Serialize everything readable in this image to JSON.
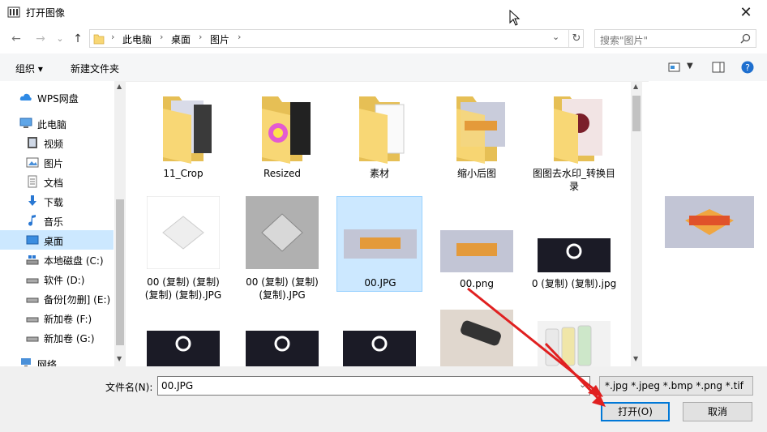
{
  "window": {
    "title": "打开图像",
    "close_glyph": "✕"
  },
  "nav": {
    "back_glyph": "←",
    "forward_glyph": "→",
    "recent_glyph": "⌄",
    "up_glyph": "↑",
    "breadcrumbs": [
      "此电脑",
      "桌面",
      "图片"
    ],
    "refresh_glyph": "↻",
    "search_placeholder": "搜索\"图片\""
  },
  "toolbar": {
    "organize_label": "组织 ▾",
    "new_folder_label": "新建文件夹"
  },
  "sidebar": {
    "items": [
      {
        "label": "WPS网盘",
        "icon": "cloud-icon"
      },
      {
        "label": "此电脑",
        "icon": "computer-icon"
      },
      {
        "label": "视频",
        "icon": "video-icon"
      },
      {
        "label": "图片",
        "icon": "pictures-icon"
      },
      {
        "label": "文档",
        "icon": "document-icon"
      },
      {
        "label": "下载",
        "icon": "download-icon"
      },
      {
        "label": "音乐",
        "icon": "music-icon"
      },
      {
        "label": "桌面",
        "icon": "desktop-icon",
        "selected": true
      },
      {
        "label": "本地磁盘 (C:)",
        "icon": "drive-icon"
      },
      {
        "label": "软件 (D:)",
        "icon": "drive-icon"
      },
      {
        "label": "备份[勿删] (E:)",
        "icon": "drive-icon"
      },
      {
        "label": "新加卷 (F:)",
        "icon": "drive-icon"
      },
      {
        "label": "新加卷 (G:)",
        "icon": "drive-icon"
      },
      {
        "label": "网络",
        "icon": "network-icon"
      }
    ]
  },
  "files": [
    {
      "name": "11_Crop",
      "kind": "folder"
    },
    {
      "name": "Resized",
      "kind": "folder"
    },
    {
      "name": "素材",
      "kind": "folder"
    },
    {
      "name": "缩小后图",
      "kind": "folder"
    },
    {
      "name": "图图去水印_转换目录",
      "kind": "folder"
    },
    {
      "name": "00 (复制) (复制) (复制) (复制).JPG",
      "kind": "image"
    },
    {
      "name": "00 (复制) (复制) (复制).JPG",
      "kind": "image"
    },
    {
      "name": "00.JPG",
      "kind": "image",
      "selected": true
    },
    {
      "name": "00.png",
      "kind": "image"
    },
    {
      "name": "0 (复制) (复制).jpg",
      "kind": "image"
    },
    {
      "name": "",
      "kind": "image"
    },
    {
      "name": "",
      "kind": "image"
    },
    {
      "name": "",
      "kind": "image"
    },
    {
      "name": "",
      "kind": "image"
    },
    {
      "name": "",
      "kind": "image"
    }
  ],
  "bottom": {
    "filename_label": "文件名(N):",
    "filename_value": "00.JPG",
    "filter_value": "*.jpg *.jpeg *.bmp *.png *.tif",
    "open_label": "打开(O)",
    "cancel_label": "取消"
  },
  "colors": {
    "accent": "#0078d7",
    "selection": "#cce8ff",
    "folder": "#f8d775",
    "annotation_arrow": "#e02020"
  }
}
